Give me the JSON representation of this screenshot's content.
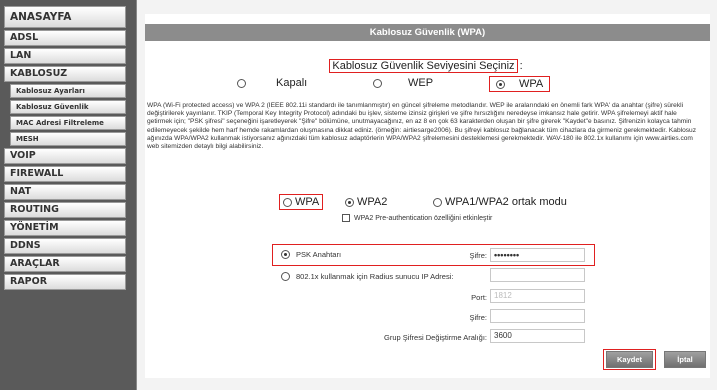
{
  "sidebar": {
    "items": [
      {
        "label": "ANASAYFA"
      },
      {
        "label": "ADSL"
      },
      {
        "label": "LAN"
      },
      {
        "label": "KABLOSUZ"
      },
      {
        "label": "Kablosuz Ayarları"
      },
      {
        "label": "Kablosuz Güvenlik"
      },
      {
        "label": "MAC Adresi Filtreleme"
      },
      {
        "label": "MESH"
      },
      {
        "label": "VOIP"
      },
      {
        "label": "FIREWALL"
      },
      {
        "label": "NAT"
      },
      {
        "label": "ROUTING"
      },
      {
        "label": "YÖNETİM"
      },
      {
        "label": "DDNS"
      },
      {
        "label": "ARAÇLAR"
      },
      {
        "label": "RAPOR"
      }
    ]
  },
  "header": {
    "title": "Kablosuz Güvenlik (WPA)"
  },
  "security": {
    "title": "Kablosuz Güvenlik Seviyesini Seçiniz",
    "options": {
      "off": "Kapalı",
      "wep": "WEP",
      "wpa": "WPA"
    },
    "selected": "WPA"
  },
  "description": "WPA (Wi-Fi protected access) ve WPA 2 (IEEE 802.11i standardı ile tanımlanmıştır) en güncel şifreleme metodlarıdır. WEP ile aralarındaki en önemli fark WPA' da anahtar (şifre) sürekli değiştirilerek yayınlanır. TKIP (Temporal Key Integrity Protocol) adındaki bu işlev, sisteme izinsiz girişleri ve şifre hırsızlığını neredeyse imkansız hale getirir. WPA şifrelemeyi aktif hale getirmek için; \"PSK şifresi\" seçeneğini işaretleyerek \"Şifre\" bölümüne, unutmayacağınız, en az 8 en çok 63 karakterden oluşan bir şifre girerek \"Kaydet\"e basınız. Şifrenizin kolayca tahmin edilemeyecek şekilde hem harf hemde rakamlardan oluşmasına dikkat ediniz. (örneğin: airtiesarge2006). Bu şifreyi kablosuz bağlanacak tüm cihazlara da girmeniz gerekmektedir. Kablosuz ağınızda WPA/WPA2 kullanmak istiyorsanız ağınızdaki tüm kablosuz adaptörlerin WPA/WPA2 şifrelemesini desteklemesi gerekmektedir. WAV-180 ile 802.1x kullanımı için www.airties.com web sitemizden detaylı bilgi alabilirsiniz.",
  "mode": {
    "wpa": "WPA",
    "wpa2": "WPA2",
    "mixed": "WPA1/WPA2 ortak modu",
    "selected": "WPA2",
    "preauth_label": "WPA2 Pre-authentication özelliğini etkinleştir"
  },
  "auth": {
    "psk_label": "PSK Anahtarı",
    "radius_label": "802.1x kullanmak için Radius sunucu IP Adresi:",
    "selected": "psk",
    "password_label": "Şifre:",
    "password_value": "••••••••",
    "radius_ip_value": "",
    "port_label": "Port:",
    "port_value": "1812",
    "radius_password_label": "Şifre:",
    "radius_password_value": "",
    "group_label": "Grup Şifresi Değiştirme Aralığı:",
    "group_value": "3600"
  },
  "buttons": {
    "save": "Kaydet",
    "cancel": "İptal"
  },
  "colors": {
    "highlight": "#e02020",
    "header": "#8c8c8c"
  }
}
